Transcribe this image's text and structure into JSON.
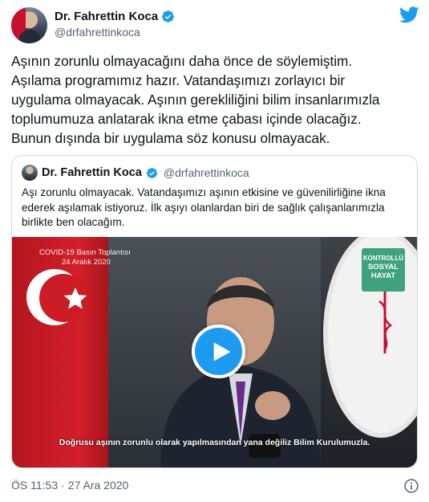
{
  "author": {
    "display_name": "Dr. Fahrettin Koca",
    "handle": "@drfahrettinkoca"
  },
  "tweet": {
    "text": "Aşının zorunlu olmayacağını daha önce de söylemiştim.\nAşılama programımız hazır. Vatandaşımızı zorlayıcı bir\nuygulama olmayacak. Aşının gerekliliğini bilim insanlarımızla\ntoplumumuza anlatarak ikna etme çabası içinde olacağız.\nBunun dışında bir uygulama söz konusu olmayacak.",
    "time": "ÖS 11:53",
    "separator": "·",
    "date": "27 Ara 2020"
  },
  "quoted_tweet": {
    "display_name": "Dr. Fahrettin Koca",
    "handle": "@drfahrettinkoca",
    "text": "Aşı zorunlu olmayacak. Vatandaşımızı aşının etkisine ve güvenilirliğine ikna\nederek aşılamak istiyoruz. İlk aşıyı olanlardan biri de sağlık çalışanlarımızla\nbirlikte ben olacağım.",
    "video": {
      "caption_line1": "COVID-19 Basın Toplantısı",
      "caption_line2": "24 Aralık 2020",
      "logo_line1": "KONTROLLÜ",
      "logo_line2": "SOSYAL",
      "logo_line3": "HAYAT",
      "subtitle": "Doğrusu aşının zorunlu olarak yapılmasından yana değiliz Bilim Kurulumuzla."
    }
  },
  "icons": {
    "brand": "twitter-bird-icon",
    "verified": "verified-badge-icon",
    "play": "play-icon",
    "info": "info-icon"
  },
  "colors": {
    "accent": "#1d9bf0",
    "secondary_text": "#536471",
    "border": "#cfd9de",
    "logo_green": "#3ea37a"
  }
}
